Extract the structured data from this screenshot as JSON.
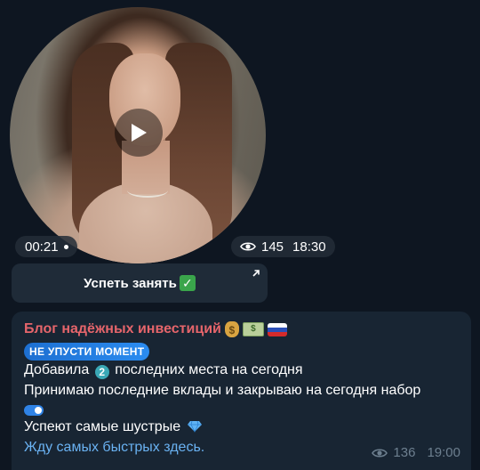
{
  "video": {
    "duration": "00:21",
    "views": "145",
    "time": "18:30"
  },
  "inline_button": {
    "label": "Успеть занять"
  },
  "message": {
    "author": "Блог надёжных инвестиций",
    "badge": "НЕ УПУСТИ МОМЕНТ",
    "line1_before": "Добавила",
    "line1_number": "2",
    "line1_after": "последних места на сегодня",
    "line2": "Принимаю последние вклады и закрываю на сегодня набор",
    "line3": "Успеют самые шустрые",
    "link_text": "Жду самых быстрых здесь.",
    "views": "136",
    "time": "19:00"
  },
  "icons": {
    "play": "play-icon",
    "eye": "eye-icon",
    "external": "external-link-icon",
    "check": "check-mark-icon",
    "money_bag": "money-bag-icon",
    "banknote": "banknote-icon",
    "flag": "russia-flag-icon",
    "toggle": "toggle-icon",
    "gem": "gem-icon"
  },
  "colors": {
    "background": "#0e1621",
    "bubble": "#182533",
    "author": "#e5656b",
    "link": "#6ab2f2",
    "badge": "#2b8cf0"
  }
}
